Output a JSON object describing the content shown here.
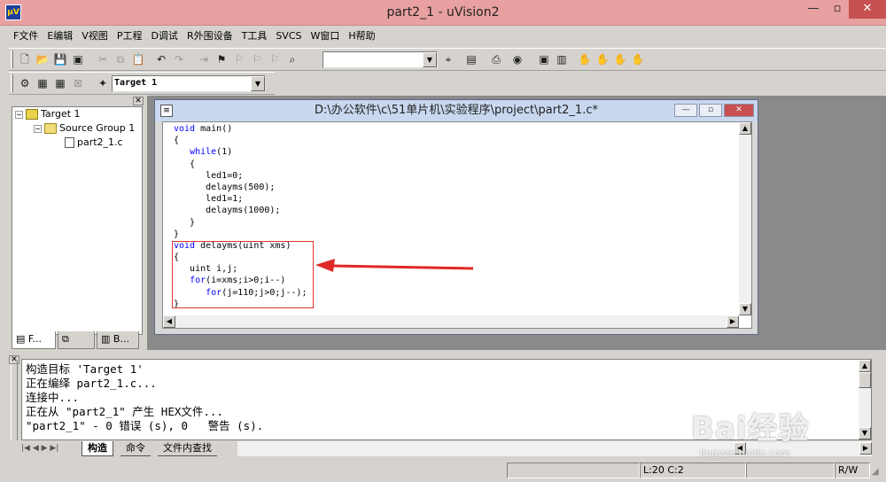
{
  "window": {
    "title": "part2_1  - uVision2",
    "app_icon_text": "µV",
    "min_glyph": "—",
    "max_glyph": "▫",
    "close_glyph": "✕"
  },
  "menu": [
    "F文件",
    "E编辑",
    "V视图",
    "P工程",
    "D调试",
    "R外围设备",
    "T工具",
    "SVCS",
    "W窗口",
    "H帮助"
  ],
  "toolbar": {
    "target_select": "Target 1",
    "find_combo_value": ""
  },
  "project_panel": {
    "close_glyph": "✕",
    "tree": {
      "target": "Target 1",
      "group": "Source Group 1",
      "file": "part2_1.c"
    },
    "tabs": [
      "F...",
      "",
      "B..."
    ]
  },
  "editor": {
    "title": "D:\\办公软件\\c\\51单片机\\实验程序\\project\\part2_1.c*",
    "lines": [
      {
        "text": "void main()",
        "kw": "void"
      },
      {
        "text": "{",
        "kw": ""
      },
      {
        "text": "   while(1)",
        "kw": "while"
      },
      {
        "text": "   {",
        "kw": ""
      },
      {
        "text": "      led1=0;",
        "kw": ""
      },
      {
        "text": "      delayms(500);",
        "kw": ""
      },
      {
        "text": "      led1=1;",
        "kw": ""
      },
      {
        "text": "      delayms(1000);",
        "kw": ""
      },
      {
        "text": "   }",
        "kw": ""
      },
      {
        "text": "}",
        "kw": ""
      },
      {
        "text": "void delayms(uint xms)",
        "kw": "void"
      },
      {
        "text": "{",
        "kw": ""
      },
      {
        "text": "   uint i,j;",
        "kw": ""
      },
      {
        "text": "   for(i=xms;i>0;i--)",
        "kw": "for"
      },
      {
        "text": "      for(j=110;j>0;j--);",
        "kw": "for"
      },
      {
        "text": "}",
        "kw": ""
      }
    ],
    "highlight_color": "#e03030",
    "arrow_color": "#e02828"
  },
  "output": {
    "lines": [
      "构造目标 'Target 1'",
      "正在编绎 part2_1.c...",
      "连接中...",
      "正在从 \"part2_1\" 产生 HEX文件...",
      "\"part2_1\" - 0 错误 (s), 0   警告 (s)."
    ],
    "tabs": [
      "构造",
      "命令",
      "文件内查找"
    ]
  },
  "status": {
    "position": "L:20 C:2",
    "mode": "R/W"
  },
  "watermark": {
    "text": "Bai经验",
    "url": "jingyan.baidu.com"
  }
}
